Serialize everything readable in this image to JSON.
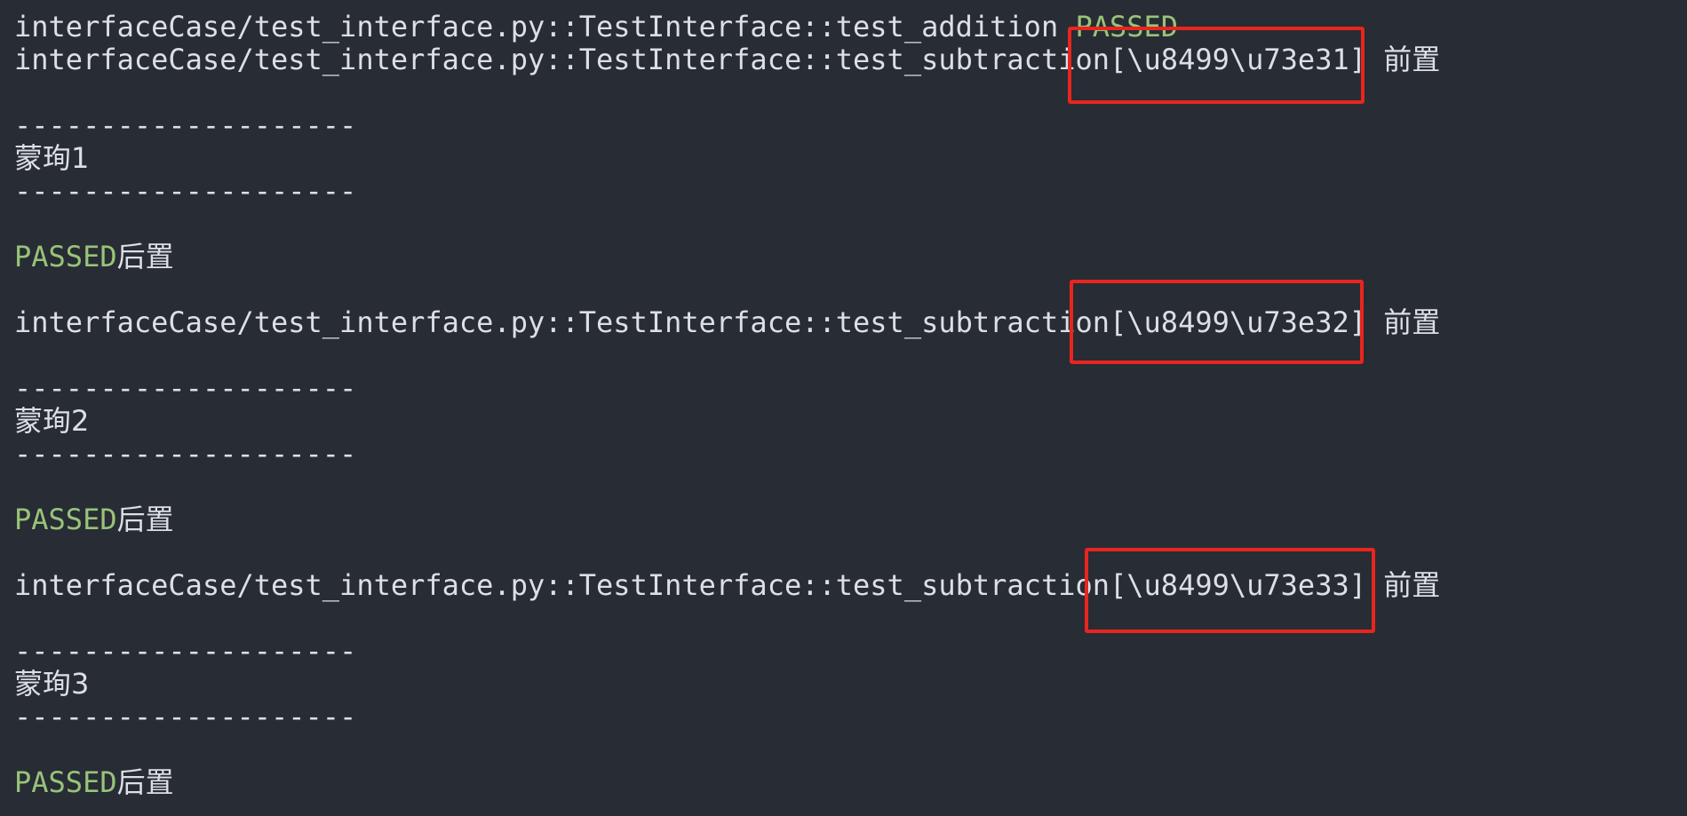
{
  "terminal": {
    "line_1": {
      "path": "interfaceCase/test_interface.py::TestInterface::test_addition ",
      "status": "PASSED"
    },
    "line_2": {
      "path": "interfaceCase/test_interface.py::TestInterface::test_subtraction[\\u8499\\u73e31] ",
      "suffix": "前置"
    },
    "line_3": "--------------------",
    "line_4": "蒙珣1",
    "line_5": "--------------------",
    "line_6": {
      "status": "PASSED",
      "suffix": "后置"
    },
    "line_7": {
      "path": "interfaceCase/test_interface.py::TestInterface::test_subtraction[\\u8499\\u73e32] ",
      "suffix": "前置"
    },
    "line_8": "--------------------",
    "line_9": "蒙珣2",
    "line_10": "--------------------",
    "line_11": {
      "status": "PASSED",
      "suffix": "后置"
    },
    "line_12": {
      "path": "interfaceCase/test_interface.py::TestInterface::test_subtraction[\\u8499\\u73e33] ",
      "suffix": "前置"
    },
    "line_13": "--------------------",
    "line_14": "蒙珣3",
    "line_15": "--------------------",
    "line_16": {
      "status": "PASSED",
      "suffix": "后置"
    }
  },
  "colors": {
    "background": "#282c34",
    "text": "#dcdfe4",
    "passed": "#98c379",
    "annotation": "#e8251e"
  }
}
